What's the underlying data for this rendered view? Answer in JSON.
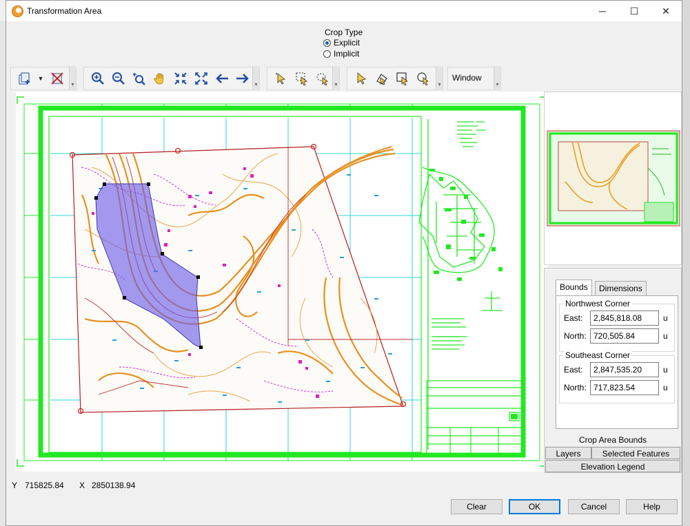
{
  "window": {
    "title": "Transformation Area",
    "minimize": "─",
    "maximize": "☐",
    "close": "✕"
  },
  "crop_type": {
    "label": "Crop Type",
    "options": [
      {
        "label": "Explicit",
        "selected": true
      },
      {
        "label": "Implicit",
        "selected": false
      }
    ]
  },
  "toolbar": {
    "window_label": "Window",
    "groups": [
      {
        "icons": [
          "add-layer-icon",
          "dropdown-arrow-icon",
          "remove-layer-icon"
        ]
      },
      {
        "icons": [
          "zoom-in-icon",
          "zoom-out-icon",
          "zoom-window-icon",
          "pan-hand-icon",
          "zoom-extents-icon",
          "zoom-fit-icon",
          "previous-view-icon",
          "next-view-icon"
        ]
      },
      {
        "icons": [
          "select-pointer-icon",
          "select-rectangle-icon",
          "select-lasso-icon"
        ]
      },
      {
        "icons": [
          "select-arrow-icon",
          "edit-node-icon",
          "edit-rectangle-icon",
          "edit-lasso-icon"
        ]
      }
    ]
  },
  "panel": {
    "tabs": [
      {
        "label": "Bounds",
        "active": true
      },
      {
        "label": "Dimensions",
        "active": false
      }
    ],
    "northwest": {
      "title": "Northwest Corner",
      "east_label": "East:",
      "east": "2,845,818.08",
      "north_label": "North:",
      "north": "720,505.84",
      "unit": "u"
    },
    "southeast": {
      "title": "Southeast Corner",
      "east_label": "East:",
      "east": "2,847,535.20",
      "north_label": "North:",
      "north": "717,823.54",
      "unit": "u"
    },
    "caption": "Crop Area Bounds",
    "bottom_tabs": {
      "layers": "Layers",
      "selected_features": "Selected Features",
      "elevation_legend": "Elevation Legend"
    }
  },
  "status": {
    "y_label": "Y",
    "y": "715825.84",
    "x_label": "X",
    "x": "2850138.94"
  },
  "buttons": {
    "clear": "Clear",
    "ok": "OK",
    "cancel": "Cancel",
    "help": "Help"
  },
  "colors": {
    "sheet_border": "#22e822",
    "grid": "#2ad4d4",
    "contour": "#e8901e",
    "road": "#b41e1e",
    "crop": "#6a5ae8"
  }
}
